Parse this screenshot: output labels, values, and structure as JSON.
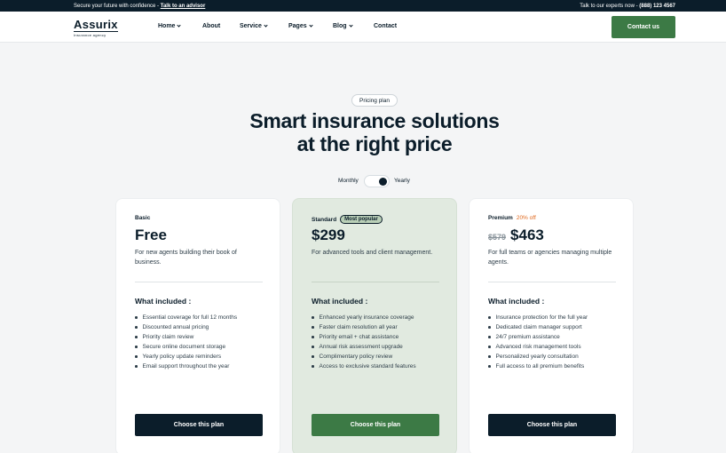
{
  "topbar": {
    "left_text": "Secure your future with confidence - ",
    "left_link": "Talk to an advisor",
    "right_text": "Talk to our experts now - ",
    "phone": "(888) 123 4567"
  },
  "logo": {
    "name": "Assurix",
    "tagline": "Insurance agency"
  },
  "nav": {
    "items": [
      {
        "label": "Home",
        "dropdown": true
      },
      {
        "label": "About",
        "dropdown": false
      },
      {
        "label": "Service",
        "dropdown": true
      },
      {
        "label": "Pages",
        "dropdown": true
      },
      {
        "label": "Blog",
        "dropdown": true
      },
      {
        "label": "Contact",
        "dropdown": false
      }
    ],
    "cta": "Contact us"
  },
  "hero": {
    "badge": "Pricing plan",
    "title_line1": "Smart insurance solutions",
    "title_line2": "at the right price"
  },
  "billing_toggle": {
    "left": "Monthly",
    "right": "Yearly",
    "selected": "Yearly"
  },
  "plans": [
    {
      "tier": "Basic",
      "price": "Free",
      "description": "For new agents building their book of business.",
      "included_label": "What included :",
      "features": [
        "Essential coverage for full 12 months",
        "Discounted annual pricing",
        "Priority claim review",
        "Secure online document storage",
        "Yearly policy update reminders",
        "Email support throughout the year"
      ],
      "button": "Choose this plan"
    },
    {
      "tier": "Standard",
      "badge": "Most popular",
      "price": "$299",
      "description": "For advanced tools and client management.",
      "included_label": "What included :",
      "features": [
        "Enhanced yearly insurance coverage",
        "Faster claim resolution all year",
        "Priority email + chat assistance",
        "Annual risk assessment upgrade",
        "Complimentary policy review",
        "Access to exclusive standard features"
      ],
      "button": "Choose this plan"
    },
    {
      "tier": "Premium",
      "discount": "20% off",
      "old_price": "$579",
      "price": "$463",
      "description": "For full teams or agencies managing multiple agents.",
      "included_label": "What included :",
      "features": [
        "Insurance protection for the full year",
        "Dedicated claim manager support",
        "24/7 premium assistance",
        "Advanced risk management tools",
        "Personalized yearly consultation",
        "Full access to all premium benefits"
      ],
      "button": "Choose this plan"
    }
  ],
  "colors": {
    "navy": "#0b1d2a",
    "green": "#3c7a45",
    "featured_bg": "#e1eae0",
    "discount": "#e16a1f"
  }
}
